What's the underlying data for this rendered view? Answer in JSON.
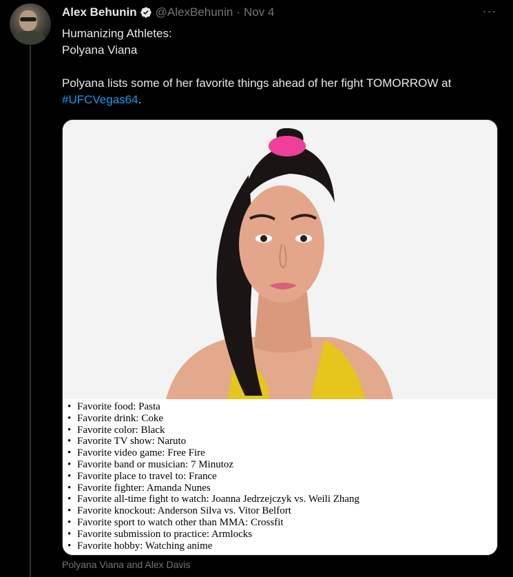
{
  "tweet": {
    "author_name": "Alex Behunin",
    "handle": "@AlexBehunin",
    "separator": "·",
    "date": "Nov 4",
    "more_icon": "···",
    "text_line1": "Humanizing Athletes:",
    "text_line2": "Polyana Viana",
    "text_body": "Polyana lists some of her favorite things ahead of her fight TOMORROW at",
    "hashtag": "#UFCVegas64",
    "trailing": "."
  },
  "media": {
    "favorites": [
      "Favorite food: Pasta",
      "Favorite drink: Coke",
      "Favorite color: Black",
      "Favorite TV show: Naruto",
      "Favorite video game: Free Fire",
      "Favorite band or musician: 7 Minutoz",
      "Favorite place to travel to: France",
      "Favorite fighter: Amanda Nunes",
      "Favorite all-time fight to watch: Joanna Jedrzejczyk vs. Weili Zhang",
      "Favorite knockout: Anderson Silva vs. Vitor Belfort",
      "Favorite sport to watch other than MMA: Crossfit",
      "Favorite submission to practice: Armlocks",
      "Favorite hobby: Watching anime"
    ]
  },
  "caption": "Polyana Viana and Alex Davis",
  "colors": {
    "background": "#000000",
    "text": "#e7e9ea",
    "muted": "#71767b",
    "link": "#1d9bf0",
    "verified": "#1d9bf0"
  }
}
